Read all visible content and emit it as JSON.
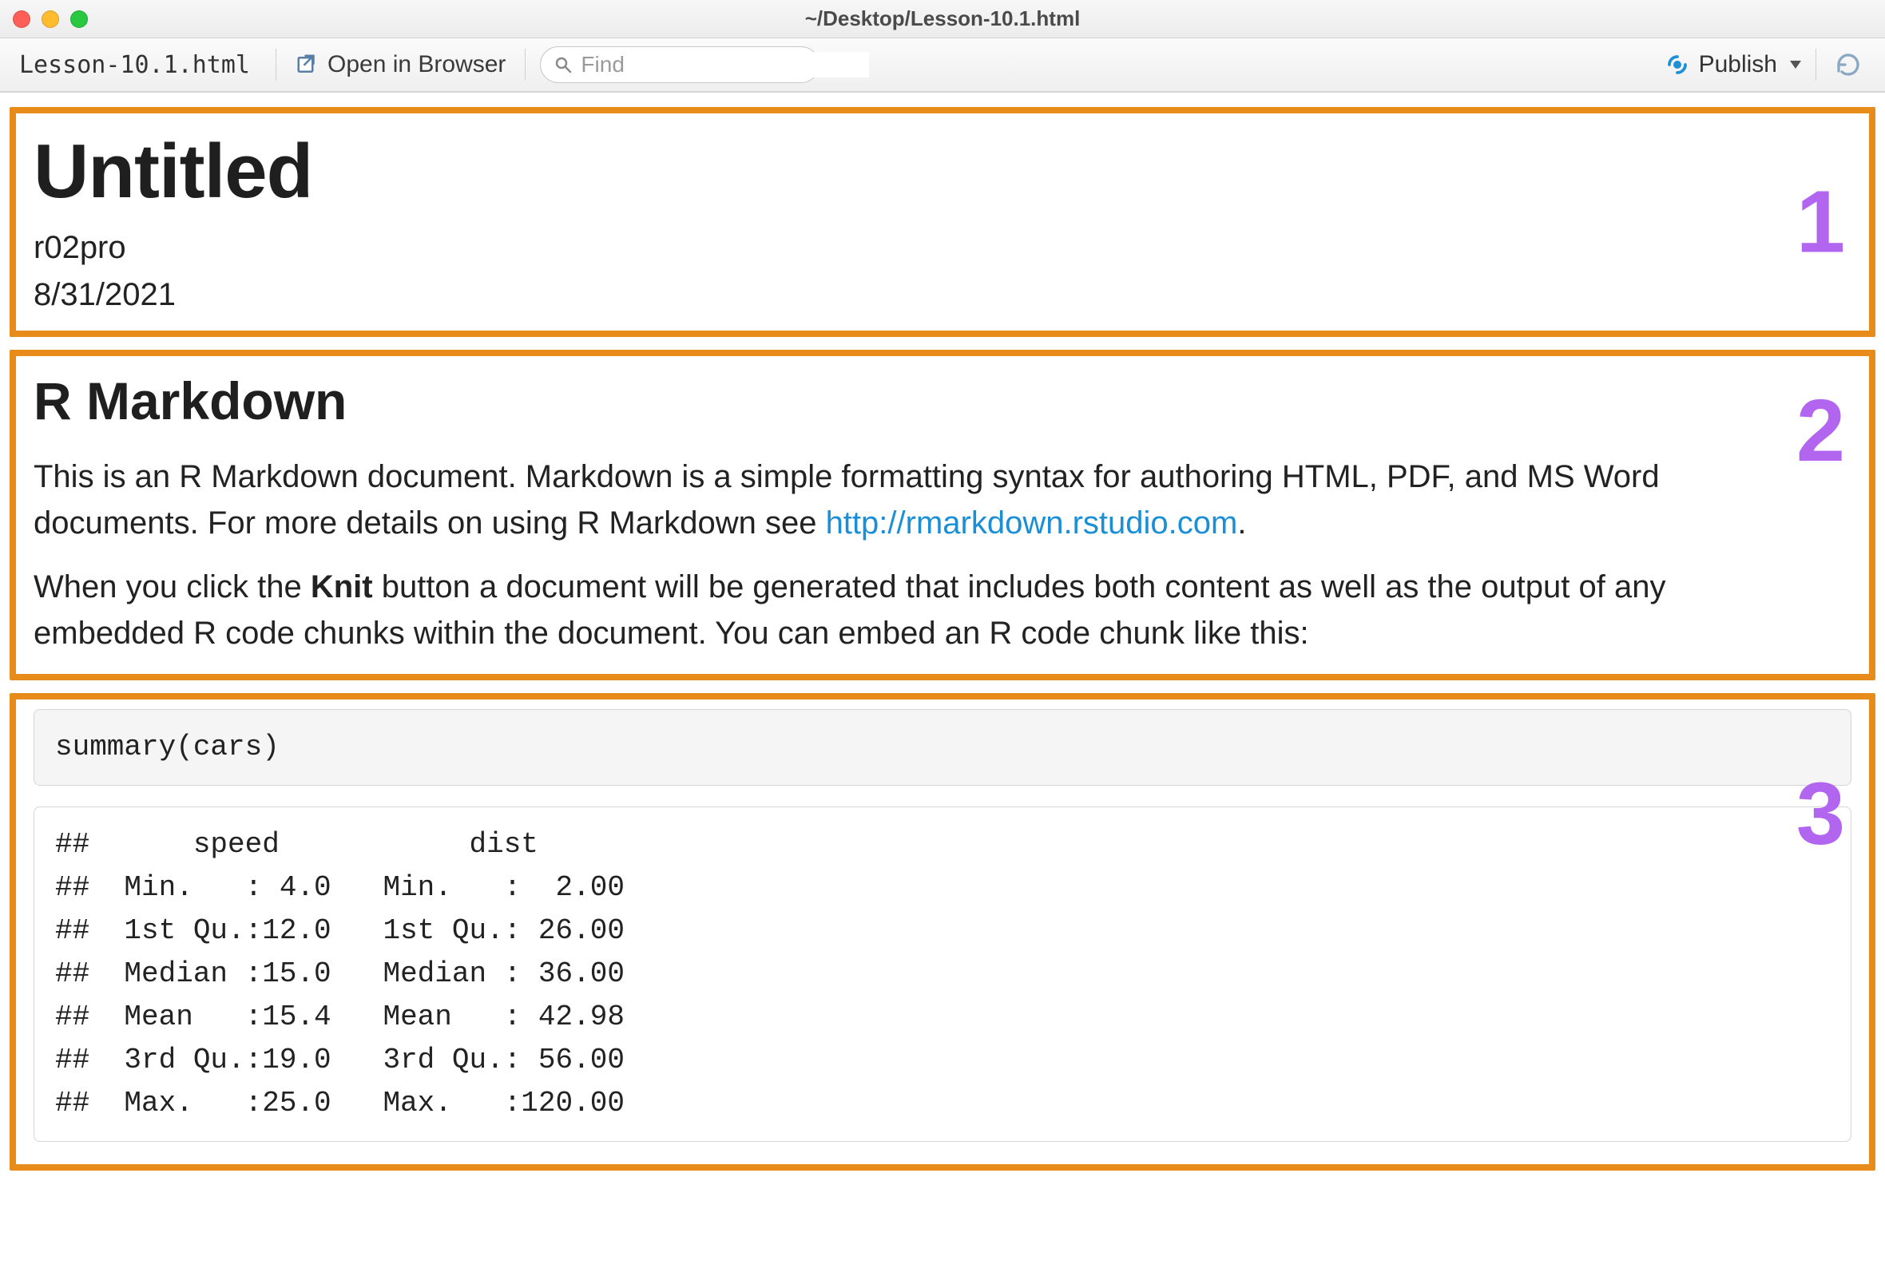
{
  "window": {
    "path": "~/Desktop/Lesson-10.1.html"
  },
  "toolbar": {
    "filename": "Lesson-10.1.html",
    "open_in_browser": "Open in Browser",
    "find_placeholder": "Find",
    "publish": "Publish"
  },
  "annotations": {
    "one": "1",
    "two": "2",
    "three": "3"
  },
  "header": {
    "title": "Untitled",
    "author": "r02pro",
    "date": "8/31/2021"
  },
  "section": {
    "heading": "R Markdown",
    "p1_a": "This is an R Markdown document. Markdown is a simple formatting syntax for authoring HTML, PDF, and MS Word documents. For more details on using R Markdown see ",
    "p1_link_text": "http://rmarkdown.rstudio.com",
    "p1_b": ".",
    "p2_a": "When you click the ",
    "p2_bold": "Knit",
    "p2_b": " button a document will be generated that includes both content as well as the output of any embedded R code chunks within the document. You can embed an R code chunk like this:"
  },
  "code": {
    "input": "summary(cars)",
    "output": "##      speed           dist       \n##  Min.   : 4.0   Min.   :  2.00  \n##  1st Qu.:12.0   1st Qu.: 26.00  \n##  Median :15.0   Median : 36.00  \n##  Mean   :15.4   Mean   : 42.98  \n##  3rd Qu.:19.0   3rd Qu.: 56.00  \n##  Max.   :25.0   Max.   :120.00"
  }
}
